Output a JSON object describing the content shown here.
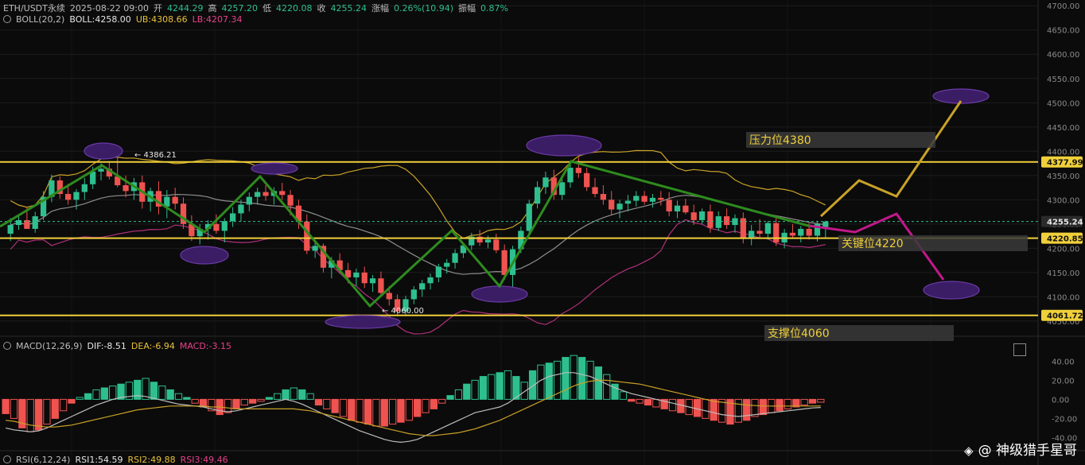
{
  "header": {
    "symbol": "ETH/USDT永续",
    "time": "2025-08-22 09:00",
    "open_label": "开",
    "open": "4244.29",
    "high_label": "高",
    "high": "4257.20",
    "low_label": "低",
    "low": "4220.08",
    "close_label": "收",
    "close": "4255.24",
    "change_label": "涨幅",
    "change": "0.26%(10.94)",
    "amp_label": "振幅",
    "amp": "0.87%"
  },
  "boll": {
    "label": "BOLL(20,2)",
    "mid": "BOLL:4258.00",
    "ub": "UB:4308.66",
    "lb": "LB:4207.34"
  },
  "macd": {
    "label": "MACD(12,26,9)",
    "dif": "DIF:-8.51",
    "dea": "DEA:-6.94",
    "macd": "MACD:-3.15"
  },
  "rsi": {
    "label": "RSI(6,12,24)",
    "rsi1": "RSI1:54.59",
    "rsi2": "RSI2:49.88",
    "rsi3": "RSI3:49.46"
  },
  "watermark": "@ 神级猎手星哥",
  "colors": {
    "up": "#2fbf8f",
    "down": "#ef5350",
    "level": "#f0d03a",
    "trend": "#2e8b1f",
    "ellipse": "#3b1d66",
    "bull_path": "#c9a227",
    "bear_path": "#c2188a"
  },
  "chart_data": [
    {
      "type": "candlestick",
      "title": "ETH/USDT永续",
      "y_axis_ticks": [
        4700,
        4650,
        4600,
        4550,
        4500,
        4450,
        4400,
        4350,
        4300,
        4250,
        4200,
        4150,
        4100,
        4050
      ],
      "y_axis_tick_labels": [
        "4700.00",
        "4650.00",
        "4600.00",
        "4550.00",
        "4500.00",
        "4450.00",
        "4400.00",
        "4350.00",
        "4300.00",
        "4250.00",
        "4200.00",
        "4150.00",
        "4100.00",
        "4050.00"
      ],
      "ylim": [
        4040,
        4702
      ],
      "price_tags": [
        {
          "value": 4377.99,
          "label": "4377.99",
          "style": "level"
        },
        {
          "value": 4255.24,
          "label": "4255.24",
          "style": "current"
        },
        {
          "value": 4220.85,
          "label": "4220.85",
          "style": "level"
        },
        {
          "value": 4061.72,
          "label": "4061.72",
          "style": "level"
        }
      ],
      "marks": [
        {
          "label": "4386.21",
          "value": 4386.21
        },
        {
          "label": "4060.00",
          "value": 4060.0
        }
      ],
      "annotations": [
        {
          "text": "压力位4380",
          "value": 4380
        },
        {
          "text": "关键位4220",
          "value": 4220
        },
        {
          "text": "支撑位4060",
          "value": 4060
        }
      ],
      "candles": [
        [
          4230,
          4262,
          4215,
          4248
        ],
        [
          4248,
          4270,
          4238,
          4258
        ],
        [
          4258,
          4285,
          4248,
          4240
        ],
        [
          4240,
          4275,
          4232,
          4266
        ],
        [
          4266,
          4318,
          4258,
          4306
        ],
        [
          4306,
          4352,
          4295,
          4340
        ],
        [
          4340,
          4348,
          4302,
          4312
        ],
        [
          4312,
          4333,
          4290,
          4300
        ],
        [
          4300,
          4322,
          4280,
          4316
        ],
        [
          4316,
          4345,
          4300,
          4332
        ],
        [
          4332,
          4368,
          4322,
          4358
        ],
        [
          4358,
          4375,
          4340,
          4364
        ],
        [
          4364,
          4380,
          4342,
          4348
        ],
        [
          4348,
          4386,
          4326,
          4330
        ],
        [
          4330,
          4350,
          4305,
          4318
        ],
        [
          4318,
          4345,
          4300,
          4336
        ],
        [
          4336,
          4350,
          4282,
          4296
        ],
        [
          4296,
          4325,
          4276,
          4318
        ],
        [
          4318,
          4338,
          4270,
          4286
        ],
        [
          4286,
          4320,
          4262,
          4306
        ],
        [
          4306,
          4325,
          4280,
          4292
        ],
        [
          4292,
          4305,
          4240,
          4250
        ],
        [
          4250,
          4268,
          4215,
          4225
        ],
        [
          4225,
          4250,
          4208,
          4240
        ],
        [
          4240,
          4258,
          4218,
          4250
        ],
        [
          4250,
          4270,
          4230,
          4236
        ],
        [
          4236,
          4262,
          4212,
          4256
        ],
        [
          4256,
          4285,
          4244,
          4272
        ],
        [
          4272,
          4300,
          4255,
          4290
        ],
        [
          4290,
          4315,
          4276,
          4306
        ],
        [
          4306,
          4325,
          4290,
          4316
        ],
        [
          4316,
          4330,
          4298,
          4308
        ],
        [
          4308,
          4326,
          4290,
          4318
        ],
        [
          4318,
          4335,
          4300,
          4310
        ],
        [
          4310,
          4320,
          4268,
          4288
        ],
        [
          4288,
          4300,
          4240,
          4255
        ],
        [
          4255,
          4270,
          4188,
          4195
        ],
        [
          4195,
          4212,
          4180,
          4205
        ],
        [
          4205,
          4210,
          4150,
          4160
        ],
        [
          4160,
          4182,
          4138,
          4175
        ],
        [
          4175,
          4190,
          4148,
          4155
        ],
        [
          4155,
          4170,
          4128,
          4140
        ],
        [
          4140,
          4158,
          4122,
          4150
        ],
        [
          4150,
          4162,
          4118,
          4128
        ],
        [
          4128,
          4145,
          4110,
          4138
        ],
        [
          4138,
          4152,
          4100,
          4108
        ],
        [
          4108,
          4122,
          4082,
          4095
        ],
        [
          4095,
          4105,
          4060,
          4070
        ],
        [
          4070,
          4102,
          4062,
          4095
        ],
        [
          4095,
          4122,
          4085,
          4115
        ],
        [
          4115,
          4135,
          4100,
          4128
        ],
        [
          4128,
          4148,
          4115,
          4140
        ],
        [
          4140,
          4168,
          4130,
          4162
        ],
        [
          4162,
          4178,
          4148,
          4170
        ],
        [
          4170,
          4198,
          4158,
          4190
        ],
        [
          4190,
          4212,
          4180,
          4206
        ],
        [
          4206,
          4232,
          4196,
          4224
        ],
        [
          4224,
          4238,
          4205,
          4212
        ],
        [
          4212,
          4226,
          4200,
          4218
        ],
        [
          4218,
          4230,
          4190,
          4196
        ],
        [
          4196,
          4208,
          4135,
          4145
        ],
        [
          4145,
          4205,
          4120,
          4198
        ],
        [
          4198,
          4245,
          4190,
          4236
        ],
        [
          4236,
          4300,
          4226,
          4292
        ],
        [
          4292,
          4338,
          4282,
          4326
        ],
        [
          4326,
          4358,
          4312,
          4346
        ],
        [
          4346,
          4362,
          4300,
          4310
        ],
        [
          4310,
          4344,
          4300,
          4336
        ],
        [
          4336,
          4374,
          4325,
          4366
        ],
        [
          4366,
          4388,
          4345,
          4355
        ],
        [
          4355,
          4366,
          4318,
          4326
        ],
        [
          4326,
          4345,
          4305,
          4312
        ],
        [
          4312,
          4330,
          4290,
          4300
        ],
        [
          4300,
          4318,
          4268,
          4280
        ],
        [
          4280,
          4300,
          4262,
          4292
        ],
        [
          4292,
          4310,
          4276,
          4298
        ],
        [
          4298,
          4318,
          4286,
          4308
        ],
        [
          4308,
          4318,
          4290,
          4296
        ],
        [
          4296,
          4312,
          4284,
          4304
        ],
        [
          4304,
          4318,
          4288,
          4300
        ],
        [
          4300,
          4316,
          4266,
          4276
        ],
        [
          4276,
          4298,
          4262,
          4288
        ],
        [
          4288,
          4302,
          4270,
          4274
        ],
        [
          4274,
          4290,
          4248,
          4258
        ],
        [
          4258,
          4282,
          4250,
          4276
        ],
        [
          4276,
          4290,
          4232,
          4242
        ],
        [
          4242,
          4276,
          4236,
          4266
        ],
        [
          4266,
          4282,
          4240,
          4248
        ],
        [
          4248,
          4270,
          4232,
          4262
        ],
        [
          4262,
          4274,
          4210,
          4222
        ],
        [
          4222,
          4248,
          4206,
          4236
        ],
        [
          4236,
          4260,
          4220,
          4230
        ],
        [
          4230,
          4256,
          4218,
          4252
        ],
        [
          4252,
          4268,
          4205,
          4212
        ],
        [
          4212,
          4240,
          4200,
          4232
        ],
        [
          4232,
          4250,
          4220,
          4226
        ],
        [
          4226,
          4246,
          4212,
          4240
        ],
        [
          4240,
          4252,
          4218,
          4226
        ],
        [
          4226,
          4256,
          4214,
          4250
        ],
        [
          4244,
          4257,
          4220,
          4255
        ]
      ]
    },
    {
      "type": "bar",
      "title": "MACD(12,26,9)",
      "y_axis_ticks": [
        40,
        20,
        0,
        -20,
        -40
      ],
      "y_axis_tick_labels": [
        "40.00",
        "20.00",
        "0.00",
        "-20.00",
        "-40.00"
      ],
      "ylim": [
        -48,
        52
      ],
      "histogram": [
        -15,
        -20,
        -30,
        -34,
        -32,
        -26,
        -20,
        -12,
        -4,
        2,
        6,
        10,
        12,
        14,
        16,
        18,
        20,
        22,
        18,
        14,
        10,
        6,
        2,
        -4,
        -8,
        -12,
        -16,
        -14,
        -10,
        -6,
        -4,
        -2,
        2,
        6,
        10,
        12,
        10,
        6,
        -6,
        -10,
        -14,
        -18,
        -22,
        -24,
        -26,
        -28,
        -28,
        -26,
        -24,
        -22,
        -18,
        -14,
        -10,
        -4,
        4,
        10,
        16,
        20,
        24,
        26,
        28,
        30,
        24,
        18,
        30,
        36,
        38,
        40,
        44,
        46,
        44,
        40,
        34,
        26,
        16,
        8,
        -2,
        -4,
        -6,
        -8,
        -10,
        -12,
        -14,
        -16,
        -18,
        -20,
        -22,
        -24,
        -26,
        -24,
        -22,
        -18,
        -16,
        -14,
        -12,
        -10,
        -8,
        -6,
        -4,
        -3
      ],
      "dif": [
        -30,
        -32,
        -33,
        -34,
        -33,
        -30,
        -26,
        -22,
        -18,
        -14,
        -10,
        -6,
        -3,
        0,
        2,
        3,
        4,
        3,
        1,
        -1,
        -3,
        -5,
        -6,
        -7,
        -8,
        -10,
        -12,
        -13,
        -12,
        -10,
        -8,
        -6,
        -4,
        -2,
        0,
        -2,
        -5,
        -9,
        -13,
        -17,
        -21,
        -25,
        -29,
        -33,
        -36,
        -39,
        -42,
        -44,
        -45,
        -44,
        -42,
        -38,
        -34,
        -30,
        -26,
        -22,
        -18,
        -14,
        -12,
        -10,
        -8,
        -4,
        2,
        8,
        14,
        20,
        24,
        26,
        28,
        28,
        26,
        24,
        20,
        16,
        12,
        9,
        6,
        4,
        2,
        0,
        -2,
        -4,
        -6,
        -8,
        -10,
        -12,
        -14,
        -16,
        -17,
        -18,
        -17,
        -16,
        -15,
        -14,
        -13,
        -12,
        -11,
        -10,
        -9,
        -8.51
      ],
      "dea": [
        -22,
        -23,
        -25,
        -27,
        -28,
        -29,
        -29,
        -28,
        -27,
        -25,
        -23,
        -21,
        -19,
        -17,
        -15,
        -13,
        -11,
        -10,
        -9,
        -8,
        -7,
        -7,
        -7,
        -7,
        -7,
        -8,
        -8,
        -9,
        -10,
        -10,
        -10,
        -10,
        -10,
        -10,
        -10,
        -10,
        -11,
        -12,
        -14,
        -16,
        -18,
        -20,
        -22,
        -24,
        -26,
        -28,
        -30,
        -32,
        -34,
        -36,
        -37,
        -38,
        -38,
        -37,
        -36,
        -35,
        -33,
        -31,
        -28,
        -25,
        -22,
        -18,
        -14,
        -10,
        -6,
        -2,
        2,
        6,
        10,
        14,
        17,
        19,
        20,
        20,
        19,
        18,
        17,
        16,
        14,
        12,
        10,
        8,
        6,
        4,
        2,
        0,
        -2,
        -3,
        -4,
        -5,
        -6,
        -6.5,
        -7,
        -7,
        -7,
        -7,
        -7,
        -7,
        -7,
        -6.94
      ]
    }
  ]
}
